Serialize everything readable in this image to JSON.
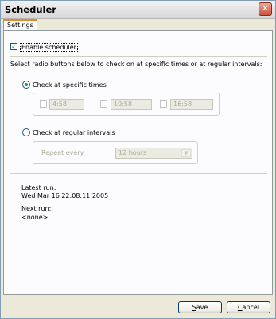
{
  "window": {
    "title": "Scheduler",
    "close_symbol": "✕"
  },
  "tabs": [
    {
      "label": "Settings"
    }
  ],
  "settings": {
    "enable_label": "Enable scheduler",
    "enable_checked": true,
    "instructions": "Select radio buttons below to check on at specific times or at regular intervals:",
    "specific": {
      "label": "Check at specific times",
      "selected": true,
      "times": [
        {
          "value": "4:58",
          "checked": false
        },
        {
          "value": "10:58",
          "checked": false
        },
        {
          "value": "16:58",
          "checked": false
        }
      ]
    },
    "regular": {
      "label": "Check at regular intervals",
      "selected": false,
      "repeat_label": "Repeat every",
      "repeat_value": "12 hours"
    },
    "latest_run_label": "Latest run:",
    "latest_run_value": "Wed Mar 16 22:08:11 2005",
    "next_run_label": "Next run:",
    "next_run_value": "<none>"
  },
  "buttons": {
    "save": "Save",
    "cancel": "Cancel"
  },
  "icons": {
    "check": "checkmark-icon",
    "dropdown": "chevron-down-icon",
    "close": "close-icon"
  }
}
